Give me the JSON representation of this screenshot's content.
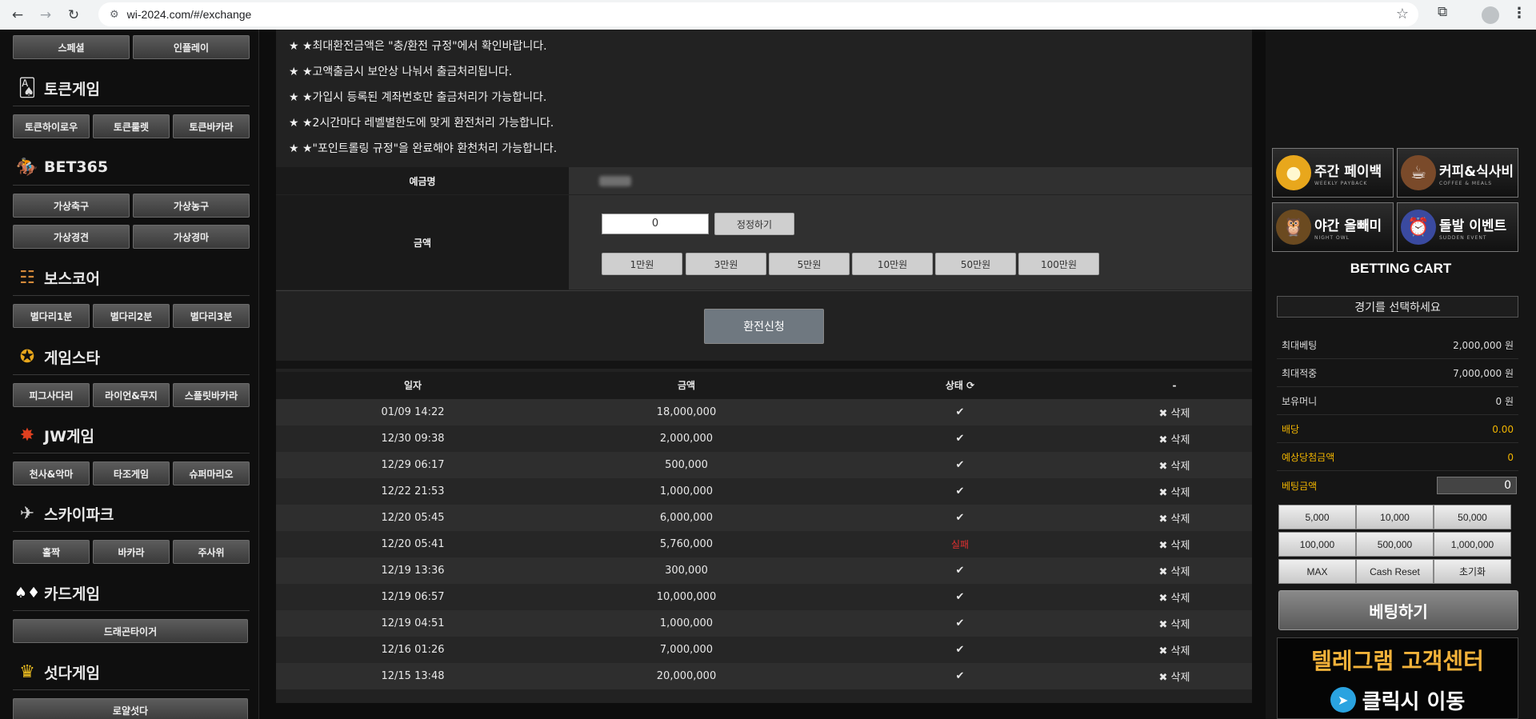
{
  "browser": {
    "url": "wi-2024.com/#/exchange",
    "back_icon": "←",
    "forward_icon": "→",
    "reload_icon": "↻",
    "tune_icon": "⚙",
    "star_icon": "☆",
    "ext_icon": "⧉",
    "menu_icon": "⋮"
  },
  "sidebar": {
    "top_buttons": [
      "스페셜",
      "인플레이"
    ],
    "sections": [
      {
        "title": "토큰게임",
        "icon": "🂡",
        "buttons": [
          "토큰하이로우",
          "토큰룰렛",
          "토큰바카라"
        ]
      },
      {
        "title": "BET365",
        "icon": "🏇",
        "buttons": [
          "가상축구",
          "가상농구",
          "가상경견",
          "가상경마"
        ]
      },
      {
        "title": "보스코어",
        "icon": "☷",
        "buttons": [
          "별다리1분",
          "별다리2분",
          "별다리3분"
        ]
      },
      {
        "title": "게임스타",
        "icon": "✪",
        "buttons": [
          "피그사다리",
          "라이언&무지",
          "스플릿바카라"
        ]
      },
      {
        "title": "JW게임",
        "icon": "✸",
        "buttons": [
          "천사&악마",
          "타조게임",
          "슈퍼마리오"
        ]
      },
      {
        "title": "스카이파크",
        "icon": "✈",
        "buttons": [
          "홀짝",
          "바카라",
          "주사위"
        ]
      },
      {
        "title": "카드게임",
        "icon": "♠♦",
        "buttons": [
          "드래곤타이거"
        ]
      },
      {
        "title": "섯다게임",
        "icon": "♛",
        "buttons": [
          "로얄섯다"
        ]
      }
    ]
  },
  "notices": [
    "★ ★최대환전금액은 \"충/환전 규정\"에서 확인바랍니다.",
    "★ ★고액출금시 보안상 나눠서 출금처리됩니다.",
    "★ ★가입시 등록된 계좌번호만 출금처리가 가능합니다.",
    "★ ★2시간마다 레벨별한도에 맞게 환전처리 가능합니다.",
    "★ ★\"포인트롤링 규정\"을 완료해야 환천처리 가능합니다."
  ],
  "form": {
    "depositor_label": "예금명",
    "amount_label": "금액",
    "amount_value": "0",
    "correct_button": "정정하기",
    "quick_amounts": [
      "1만원",
      "3만원",
      "5만원",
      "10만원",
      "50만원",
      "100만원"
    ],
    "submit_button": "환전신청"
  },
  "history": {
    "headers": [
      "일자",
      "금액",
      "상태",
      "-"
    ],
    "refresh_icon": "⟳",
    "check_icon": "✔",
    "delete_label": "✖ 삭제",
    "rows": [
      {
        "date": "01/09 14:22",
        "amount": "18,000,000",
        "status": "✔"
      },
      {
        "date": "12/30 09:38",
        "amount": "2,000,000",
        "status": "✔"
      },
      {
        "date": "12/29 06:17",
        "amount": "500,000",
        "status": "✔"
      },
      {
        "date": "12/22 21:53",
        "amount": "1,000,000",
        "status": "✔"
      },
      {
        "date": "12/20 05:45",
        "amount": "6,000,000",
        "status": "✔"
      },
      {
        "date": "12/20 05:41",
        "amount": "5,760,000",
        "status": "실패"
      },
      {
        "date": "12/19 13:36",
        "amount": "300,000",
        "status": "✔"
      },
      {
        "date": "12/19 06:57",
        "amount": "10,000,000",
        "status": "✔"
      },
      {
        "date": "12/19 04:51",
        "amount": "1,000,000",
        "status": "✔"
      },
      {
        "date": "12/16 01:26",
        "amount": "7,000,000",
        "status": "✔"
      },
      {
        "date": "12/15 13:48",
        "amount": "20,000,000",
        "status": "✔"
      }
    ]
  },
  "right": {
    "banners": [
      {
        "title": "주간 페이백",
        "sub": "WEEKLY PAYBACK",
        "icon": "●",
        "color": "#e8a71c"
      },
      {
        "title": "커피&식사비",
        "sub": "COFFEE & MEALS",
        "icon": "☕",
        "color": "#7a4a2a"
      },
      {
        "title": "야간 올빼미",
        "sub": "NIGHT OWL",
        "icon": "🦉",
        "color": "#6b4a20"
      },
      {
        "title": "돌발 이벤트",
        "sub": "SUDDEN EVENT",
        "icon": "⏰",
        "color": "#3a4aa0"
      }
    ],
    "cart_title": "BETTING CART",
    "select_match": "경기를 선택하세요",
    "info": [
      {
        "label": "최대베팅",
        "value": "2,000,000 원"
      },
      {
        "label": "최대적중",
        "value": "7,000,000 원"
      },
      {
        "label": "보유머니",
        "value": "0 원"
      },
      {
        "label": "배당",
        "value": "0.00"
      },
      {
        "label": "예상당첨금액",
        "value": "0"
      }
    ],
    "bet_amount_label": "베팅금액",
    "bet_amount_value": "0",
    "chips": [
      "5,000",
      "10,000",
      "50,000",
      "100,000",
      "500,000",
      "1,000,000",
      "MAX",
      "Cash Reset",
      "초기화"
    ],
    "bet_button": "베팅하기",
    "telegram_top": "텔레그램 고객센터",
    "telegram_bottom": "클릭시 이동",
    "telegram_icon": "➤"
  }
}
